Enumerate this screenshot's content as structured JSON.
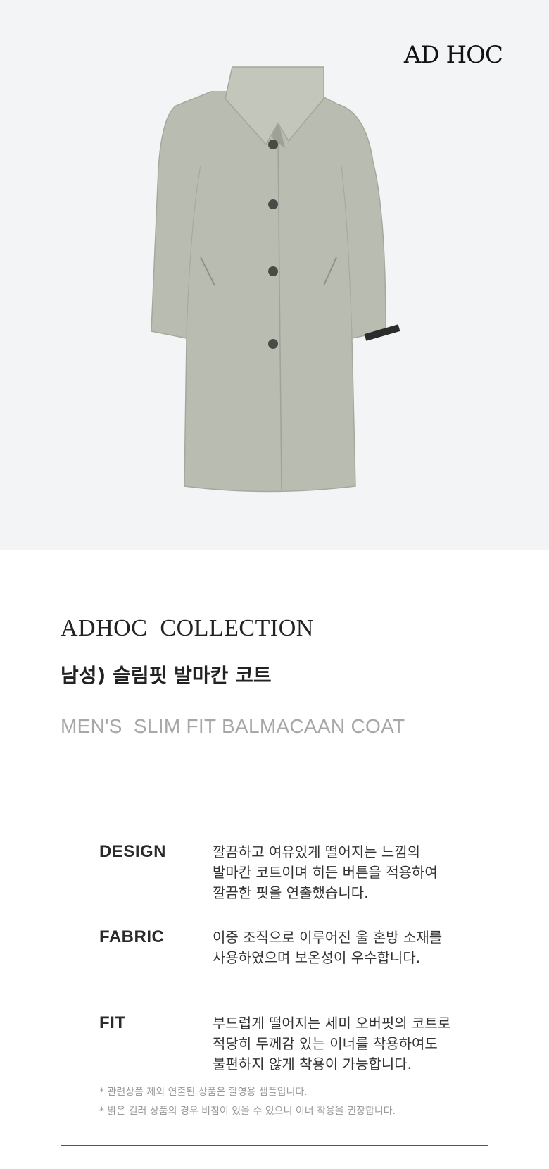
{
  "hero": {
    "brand": "AD HOC",
    "background_color": "#f3f4f6",
    "product_color": "#b9bcb0",
    "image_alt": "coat-image"
  },
  "product": {
    "collection": "ADHOC  COLLECTION",
    "name_ko": "남성) 슬림핏 발마칸 코트",
    "name_en": "MEN'S  SLIM FIT BALMACAAN COAT"
  },
  "specs": [
    {
      "label": "DESIGN",
      "lines": [
        "깔끔하고 여유있게 떨어지는 느낌의",
        "발마칸 코트이며 히든 버튼을 적용하여",
        "깔끔한 핏을 연출했습니다."
      ]
    },
    {
      "label": "FABRIC",
      "lines": [
        "이중 조직으로 이루어진 울 혼방 소재를",
        "사용하였으며 보온성이 우수합니다."
      ]
    },
    {
      "label": "FIT",
      "lines": [
        "부드럽게 떨어지는 세미 오버핏의 코트로",
        "적당히 두께감 있는 이너를 착용하여도",
        "불편하지 않게 착용이 가능합니다."
      ]
    }
  ],
  "notes": [
    "* 관련상품 제외 연출된 상품은 촬영용 샘플입니다.",
    "* 밝은 컬러 상품의 경우 비침이 있을 수 있으니 이너 착용을 권장합니다."
  ]
}
